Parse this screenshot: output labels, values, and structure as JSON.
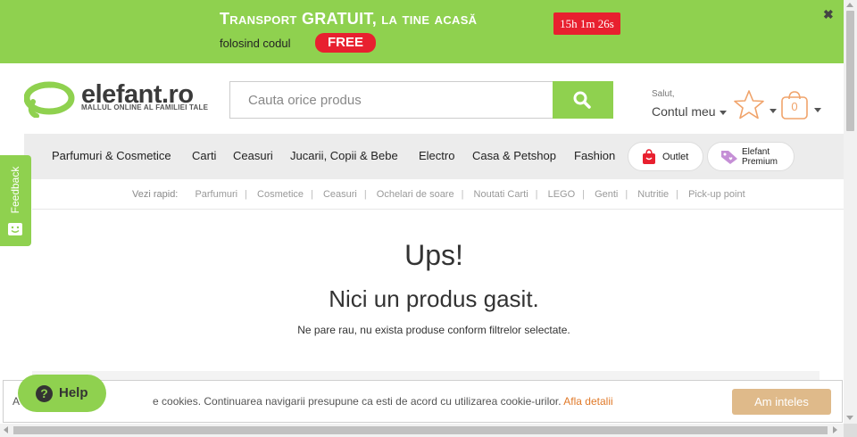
{
  "promo": {
    "title": "Transport GRATUIT, la tine acasă",
    "code_prefix": "folosind codul",
    "code": "FREE",
    "timer": "15h 1m 26s",
    "close_label": "✖"
  },
  "header": {
    "logo_name": "elefant.ro",
    "logo_tagline": "MALLUL ONLINE AL FAMILIEI TALE",
    "search_placeholder": "Cauta orice produs",
    "account_greeting": "Salut,",
    "account_menu": "Contul meu",
    "cart_count": "0"
  },
  "nav": {
    "items": [
      "Parfumuri & Cosmetice",
      "Carti",
      "Ceasuri",
      "Jucarii, Copii & Bebe",
      "Electro",
      "Casa & Petshop",
      "Fashion"
    ],
    "outlet_label": "Outlet",
    "premium_label": "Elefant Premium"
  },
  "quick_links": {
    "label": "Vezi rapid:",
    "items": [
      "Parfumuri",
      "Cosmetice",
      "Ceasuri",
      "Ochelari de soare",
      "Noutati Carti",
      "LEGO",
      "Genti",
      "Nutritie",
      "Pick-up point"
    ]
  },
  "feedback_label": "Feedback",
  "message": {
    "title": "Ups!",
    "subtitle": "Nici un produs gasit.",
    "text": "Ne pare rau, nu exista produse conform filtrelor selectate."
  },
  "cookie": {
    "text_start": "A",
    "text": "e cookies. Continuarea navigarii presupune ca esti de acord cu utilizarea cookie-urilor.",
    "link": "Afla detalii",
    "button": "Am inteles"
  },
  "help_label": "Help",
  "colors": {
    "brand_green": "#8fd14f",
    "promo_red": "#e8202f",
    "accent_orange": "#f0a36a",
    "cookie_button": "#dfba8a"
  }
}
